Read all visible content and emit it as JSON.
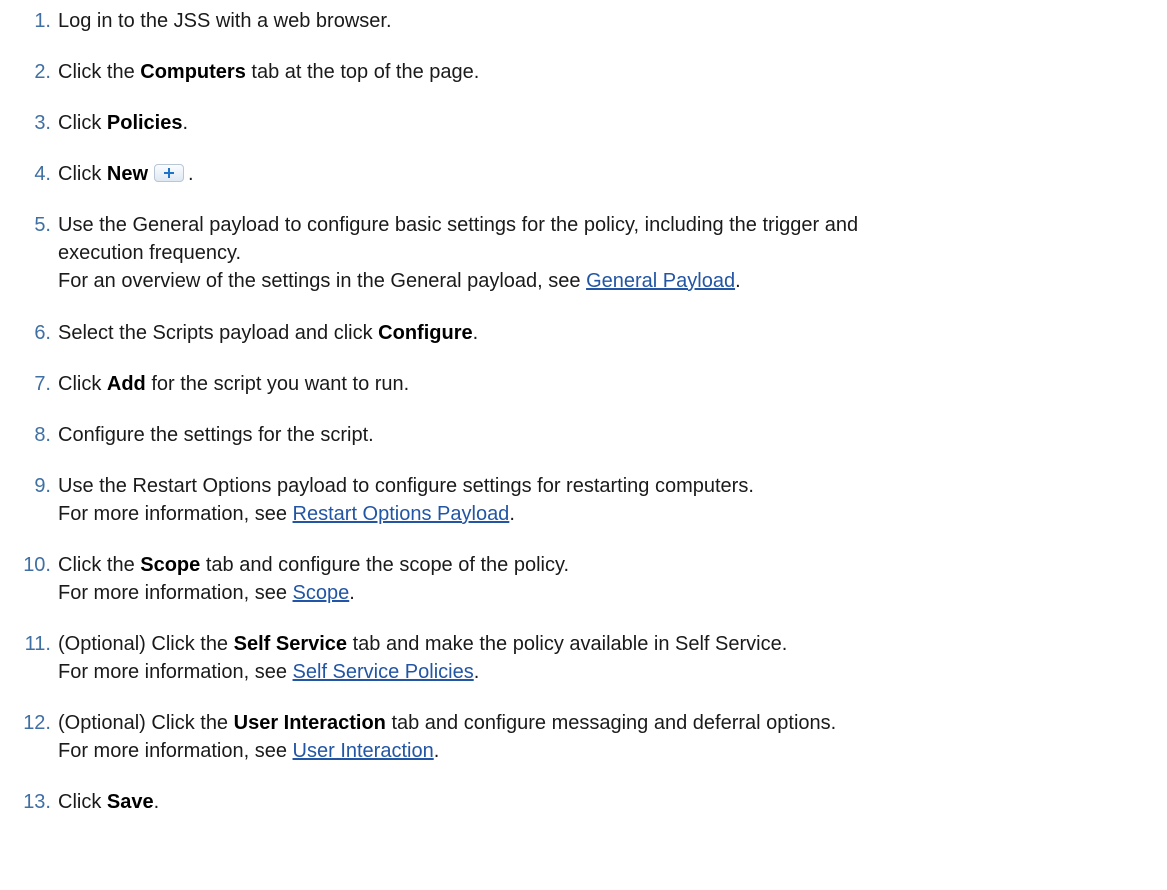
{
  "steps": [
    {
      "num": "1.",
      "pre": "Log in to the JSS with a web browser."
    },
    {
      "num": "2.",
      "pre": "Click the ",
      "bold": "Computers",
      "post": " tab at the top of the page."
    },
    {
      "num": "3.",
      "pre": "Click ",
      "bold": "Policies",
      "post": "."
    },
    {
      "num": "4.",
      "pre": "Click ",
      "bold": "New",
      "post": ".",
      "icon": "plus-button-icon"
    },
    {
      "num": "5.",
      "line1": "Use the General payload to configure basic settings for the policy, including the trigger and",
      "line2": "execution frequency.",
      "line3_pre": "For an overview of the settings in the General payload, see ",
      "line3_link": "General Payload",
      "line3_post": "."
    },
    {
      "num": "6.",
      "pre": "Select the Scripts payload and click ",
      "bold": "Configure",
      "post": "."
    },
    {
      "num": "7.",
      "pre": "Click ",
      "bold": "Add",
      "post": " for the script you want to run."
    },
    {
      "num": "8.",
      "pre": "Configure the settings for the script."
    },
    {
      "num": "9.",
      "line1": "Use the Restart Options payload to configure settings for restarting computers.",
      "line2_pre": "For more information, see ",
      "line2_link": "Restart Options Payload",
      "line2_post": "."
    },
    {
      "num": "10.",
      "pre": "Click the ",
      "bold": "Scope",
      "post": " tab and configure the scope of the policy.",
      "line2_pre": "For more information, see ",
      "line2_link": "Scope",
      "line2_post": "."
    },
    {
      "num": "11.",
      "pre": "(Optional) Click the ",
      "bold": "Self Service",
      "post": " tab and make the policy available in Self Service.",
      "line2_pre": "For more information, see ",
      "line2_link": "Self Service Policies",
      "line2_post": "."
    },
    {
      "num": "12.",
      "pre": "(Optional) Click the ",
      "bold": "User Interaction",
      "post": " tab and configure messaging and deferral options.",
      "line2_pre": "For more information, see ",
      "line2_link": "User Interaction",
      "line2_post": "."
    },
    {
      "num": "13.",
      "pre": "Click ",
      "bold": "Save",
      "post": "."
    }
  ],
  "colors": {
    "step_number": "#3f6fa3",
    "link": "#2255a4",
    "text": "#1a1a1a",
    "icon_plus": "#1e73c8"
  }
}
